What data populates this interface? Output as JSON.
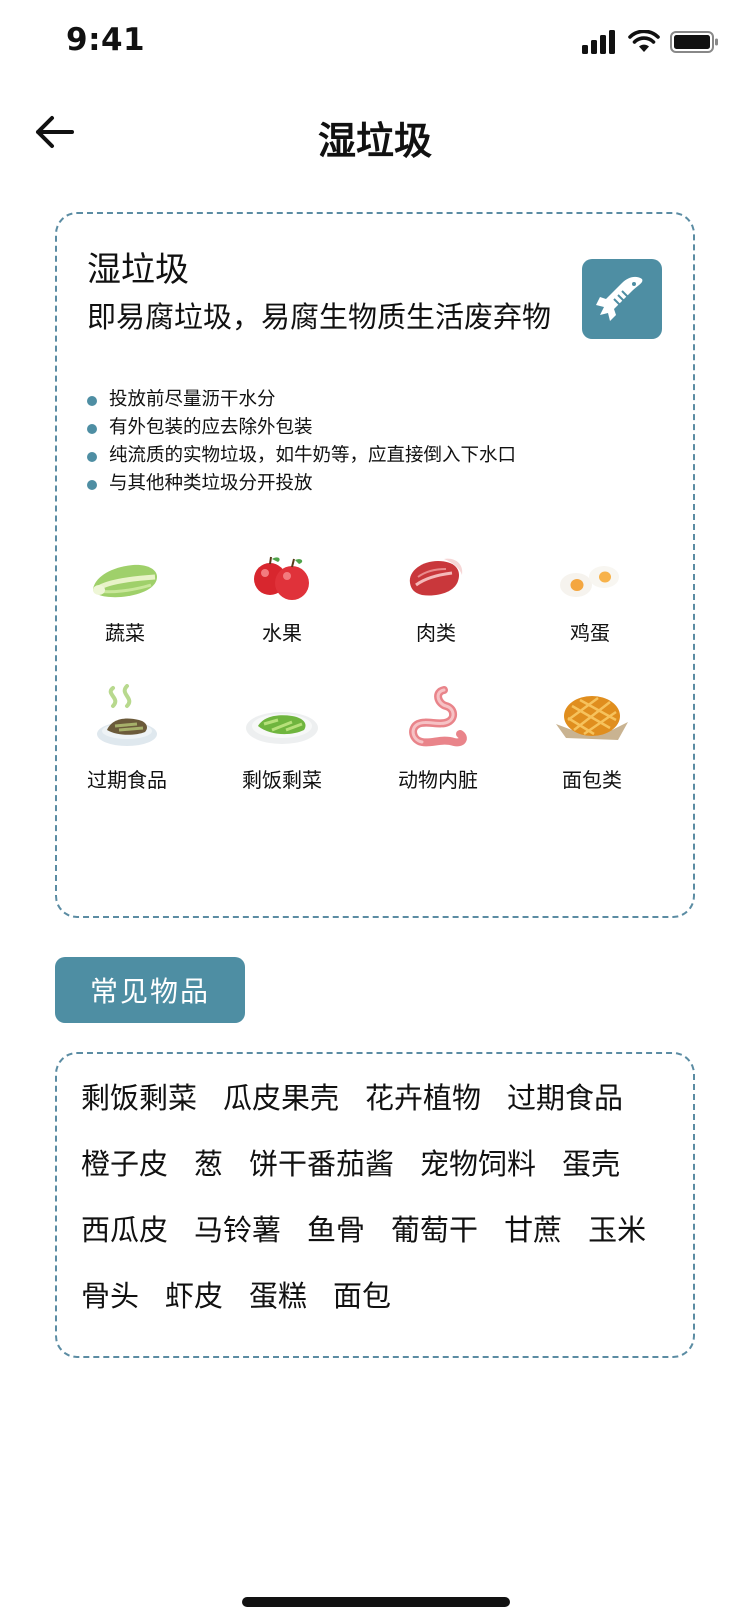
{
  "status": {
    "time": "9:41"
  },
  "nav": {
    "title": "湿垃圾"
  },
  "info": {
    "title": "湿垃圾",
    "subtitle": "即易腐垃圾，易腐生物质生活废弃物",
    "icon": "fish-bone-icon",
    "tips": [
      "投放前尽量沥干水分",
      "有外包装的应去除外包装",
      "纯流质的实物垃圾，如牛奶等，应直接倒入下水口",
      "与其他种类垃圾分开投放"
    ],
    "categories": [
      {
        "label": "蔬菜",
        "icon": "cabbage-icon"
      },
      {
        "label": "水果",
        "icon": "apple-icon"
      },
      {
        "label": "肉类",
        "icon": "meat-icon"
      },
      {
        "label": "鸡蛋",
        "icon": "egg-icon"
      },
      {
        "label": "过期食品",
        "icon": "spoiled-food-icon"
      },
      {
        "label": "剩饭剩菜",
        "icon": "leftovers-icon"
      },
      {
        "label": "动物内脏",
        "icon": "offal-icon"
      },
      {
        "label": "面包类",
        "icon": "bread-icon"
      }
    ]
  },
  "common": {
    "button_label": "常见物品",
    "items": [
      "剩饭剩菜",
      "瓜皮果壳",
      "花卉植物",
      "过期食品",
      "橙子皮",
      "葱",
      "饼干番茄酱",
      "宠物饲料",
      "蛋壳",
      "西瓜皮",
      "马铃薯",
      "鱼骨",
      "葡萄干",
      "甘蔗",
      "玉米",
      "骨头",
      "虾皮",
      "蛋糕",
      "面包"
    ]
  },
  "colors": {
    "accent": "#4e8ea3",
    "border": "#5b8ca3"
  }
}
